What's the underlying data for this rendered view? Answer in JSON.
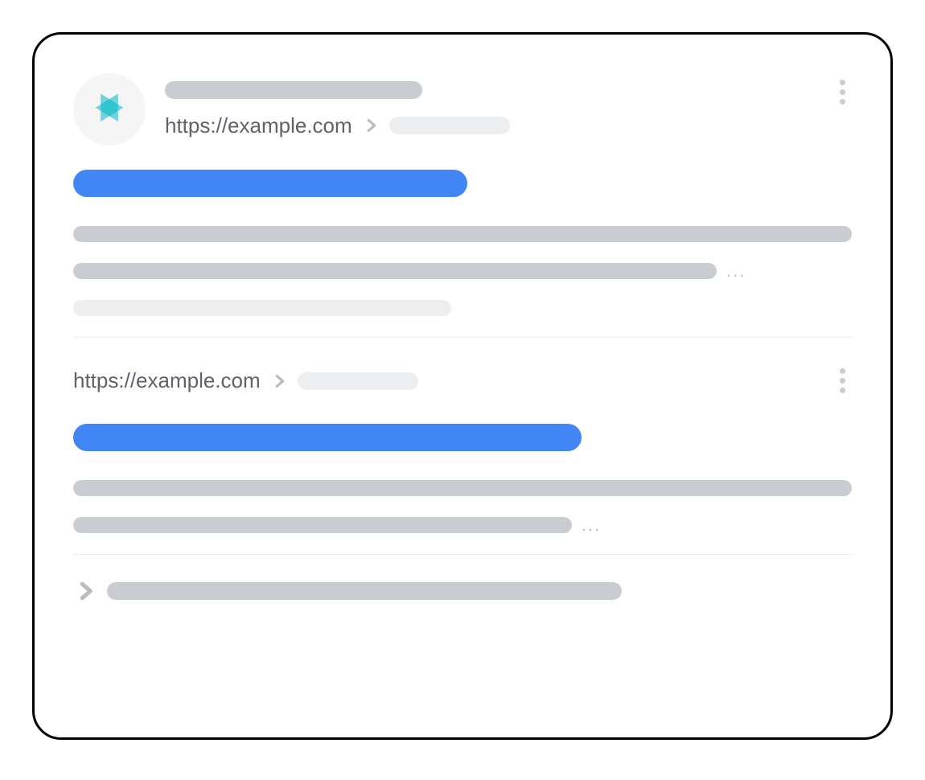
{
  "results": [
    {
      "url": "https://example.com",
      "icon": "play-star-icon"
    },
    {
      "url": "https://example.com"
    }
  ],
  "ellipsis": "...",
  "colors": {
    "link_blue": "#4285f4",
    "placeholder_gray": "#c9cdd1",
    "placeholder_light": "#eceeef",
    "text_gray": "#5f6368"
  }
}
